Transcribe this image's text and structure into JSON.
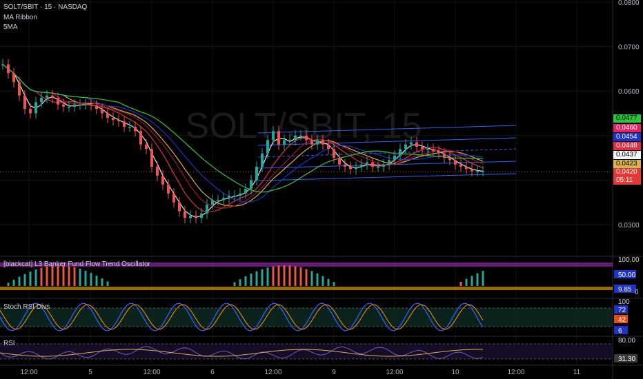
{
  "header": {
    "symbol_line": "SOLT/SBIT · 15 · NASDAQ",
    "indicator_1": "MA Ribbon",
    "indicator_2": "5MA"
  },
  "watermark": "SOLT/SBIT, 15",
  "colors": {
    "up": "#26a69a",
    "down": "#ef5350",
    "ma_white": "#e6e6e6",
    "ma_yellow": "#d8b24a",
    "ma_red": "#e03040",
    "ma_crimson": "#a0142a",
    "ma_blue": "#1e32c8",
    "ma_green": "#38c838",
    "channel": "#2962ff",
    "purple_band": "#8e24aa",
    "orange_band": "#ffb300"
  },
  "price_axis": {
    "ticks": [
      "0.0800",
      "0.0700",
      "0.0600",
      "0.0300"
    ],
    "tags": [
      {
        "text": "0.0477",
        "bg": "#26c838",
        "fg": "#000000"
      },
      {
        "text": "0.0460",
        "bg": "#e91e63",
        "fg": "#ffffff"
      },
      {
        "text": "0.0454",
        "bg": "#1e32c8",
        "fg": "#ffffff"
      },
      {
        "text": "0.0448",
        "bg": "#e03040",
        "fg": "#ffffff"
      },
      {
        "text": "0.0437",
        "bg": "#f5f5f5",
        "fg": "#000000"
      },
      {
        "text": "0.0423",
        "bg": "#d8b24a",
        "fg": "#000000"
      },
      {
        "text": "0.0420",
        "bg": "#e53935",
        "fg": "#ffffff"
      },
      {
        "text": "05:11",
        "bg": "#e53935",
        "fg": "#ffffff"
      }
    ]
  },
  "time_axis": [
    "12:00",
    "5",
    "12:00",
    "6",
    "12:00",
    "9",
    "12:00",
    "10",
    "12:00",
    "11"
  ],
  "panes": {
    "banker": {
      "title": "[blackcat] L3 Banker Fund Flow Trend Oscillator",
      "ticks": [
        "100.00",
        "50.00",
        "9.85",
        "0"
      ]
    },
    "stoch": {
      "title": "Stoch RSI Divs",
      "ticks": [
        "100",
        "72",
        "42",
        "6"
      ]
    },
    "rsi": {
      "title": "RSI",
      "ticks": [
        "80.00",
        "31.30"
      ]
    }
  },
  "chart_data": [
    {
      "type": "candlestick",
      "title": "SOLT/SBIT · 15 · NASDAQ",
      "ylim": [
        0.027,
        0.0805
      ],
      "series": [
        {
          "name": "price",
          "x": [
            0,
            8,
            16,
            24,
            32,
            40,
            48,
            56,
            64,
            72,
            80,
            88,
            96,
            104,
            112,
            120,
            128,
            136,
            144,
            152,
            160,
            168,
            176,
            184,
            192,
            200,
            208,
            216,
            224,
            232,
            240,
            248,
            256,
            264,
            272,
            280,
            288,
            296,
            304,
            312,
            320,
            328,
            336,
            344,
            352,
            360,
            368,
            376,
            384,
            392,
            400,
            408,
            416,
            424,
            432,
            440,
            448,
            456,
            464,
            472,
            480,
            488,
            496,
            504,
            512,
            520,
            528,
            536,
            544,
            552,
            560,
            568,
            576,
            584,
            592,
            600,
            608,
            616,
            624,
            632,
            640,
            648,
            656,
            664,
            672,
            680,
            688,
            696
          ],
          "y": [
            0.066,
            0.064,
            0.062,
            0.059,
            0.056,
            0.055,
            0.0575,
            0.0585,
            0.059,
            0.0585,
            0.057,
            0.0565,
            0.0565,
            0.057,
            0.057,
            0.057,
            0.0568,
            0.056,
            0.055,
            0.054,
            0.0535,
            0.0532,
            0.052,
            0.052,
            0.051,
            0.048,
            0.047,
            0.043,
            0.041,
            0.039,
            0.037,
            0.035,
            0.033,
            0.0315,
            0.032,
            0.0315,
            0.0325,
            0.0345,
            0.0355,
            0.0355,
            0.036,
            0.0365,
            0.0365,
            0.037,
            0.038,
            0.04,
            0.043,
            0.046,
            0.049,
            0.051,
            0.048,
            0.049,
            0.049,
            0.05,
            0.05,
            0.049,
            0.048,
            0.049,
            0.048,
            0.047,
            0.045,
            0.0435,
            0.043,
            0.0425,
            0.043,
            0.0435,
            0.044,
            0.043,
            0.043,
            0.0435,
            0.0445,
            0.0455,
            0.047,
            0.048,
            0.0485,
            0.0475,
            0.047,
            0.047,
            0.0465,
            0.046,
            0.045,
            0.0445,
            0.0435,
            0.043,
            0.0425,
            0.042,
            0.042,
            0.042
          ]
        }
      ]
    }
  ]
}
